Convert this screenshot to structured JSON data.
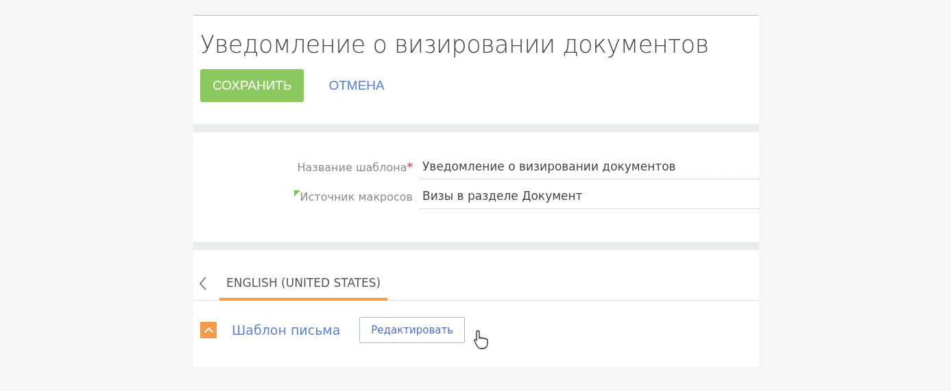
{
  "page": {
    "title": "Уведомление о визировании документов"
  },
  "actions": [
    {
      "label": "СОХРАНИТЬ",
      "kind": "primary"
    },
    {
      "label": "ОТМЕНА",
      "kind": "link"
    }
  ],
  "fields": [
    {
      "label": "Название шаблона",
      "required_mark": "*",
      "flagged": false,
      "value": "Уведомление о визировании документов"
    },
    {
      "label": "Источник макросов",
      "flagged": true,
      "value": "Визы в разделе Документ"
    }
  ],
  "tabs": [
    {
      "label": "ENGLISH (UNITED STATES)",
      "selected": true
    }
  ],
  "group": {
    "title": "Шаблон письма",
    "expanded": true,
    "button": "Редактировать"
  }
}
